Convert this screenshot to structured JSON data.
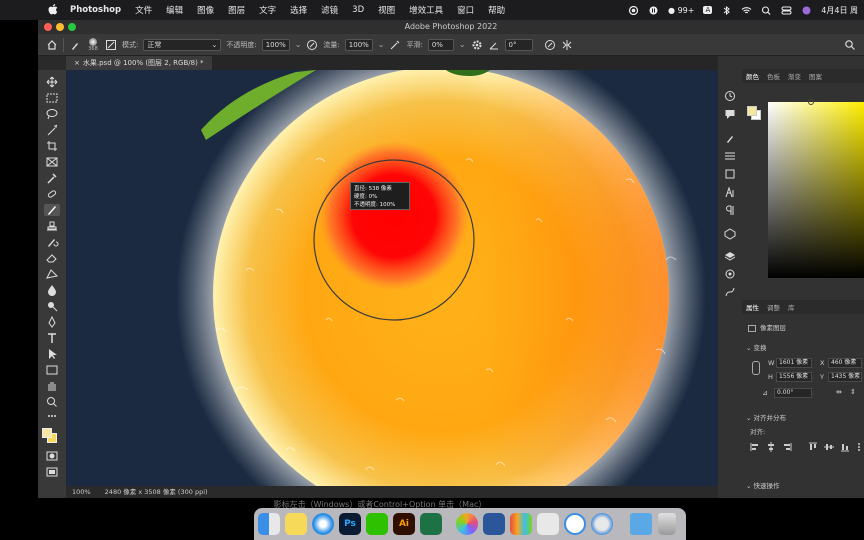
{
  "menubar": {
    "app_name": "Photoshop",
    "items": [
      "文件",
      "编辑",
      "图像",
      "图层",
      "文字",
      "选择",
      "滤镜",
      "3D",
      "视图",
      "增效工具",
      "窗口",
      "帮助"
    ],
    "notifications": "99+",
    "input_method": "A",
    "clock": "4月4日 周"
  },
  "window": {
    "title": "Adobe Photoshop 2022",
    "document_tab": "水果.psd @ 100% (图层 2, RGB/8) *"
  },
  "options_bar": {
    "brush_size": "368",
    "mode_label": "模式:",
    "mode_value": "正常",
    "opacity_label": "不透明度:",
    "opacity_value": "100%",
    "flow_label": "流量:",
    "flow_value": "100%",
    "smoothing_label": "平滑:",
    "smoothing_value": "0%",
    "angle_value": "0°"
  },
  "brush_tooltip": {
    "line1": "直径: 538 像素",
    "line2": "硬度:      0%",
    "line3": "不透明度:  100%"
  },
  "status_bar": {
    "zoom": "100%",
    "doc_info": "2480 像素 x 3508 像素 (300 ppi)"
  },
  "color_panel": {
    "tabs": [
      "颜色",
      "色板",
      "渐变",
      "图案"
    ],
    "foreground": "#f5e7a0",
    "background": "#ffffff"
  },
  "properties_panel": {
    "tabs": [
      "属性",
      "调整",
      "库"
    ],
    "layer_type": "像素图层",
    "transform_label": "变换",
    "w_label": "W",
    "w_value": "1601 像素",
    "x_label": "X",
    "x_value": "460 像素",
    "h_label": "H",
    "h_value": "1556 像素",
    "y_label": "Y",
    "y_value": "1435 像素",
    "angle_value": "0.00°",
    "align_label": "对齐并分布",
    "align_sub": "对齐:",
    "quick_actions": "快速操作"
  },
  "subtitle": "影标左击（Windows）或者Control+Option 单击（Mac）"
}
